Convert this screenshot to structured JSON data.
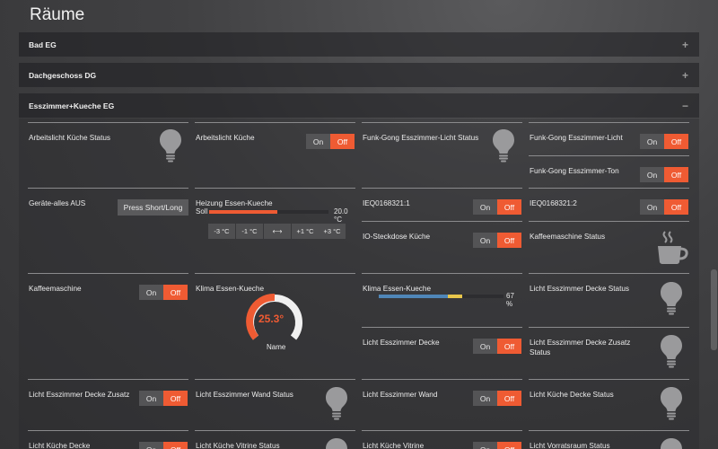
{
  "page": {
    "title": "Räume"
  },
  "panels": [
    {
      "label": "Bad EG",
      "toggle": "+"
    },
    {
      "label": "Dachgeschoss DG",
      "toggle": "+"
    },
    {
      "label": "Esszimmer+Kueche EG",
      "toggle": "−"
    }
  ],
  "switch": {
    "on": "On",
    "off": "Off"
  },
  "tiles": {
    "arbeitslicht_status": "Arbeitslicht Küche Status",
    "arbeitslicht": "Arbeitslicht Küche",
    "funkgong_status": "Funk-Gong Esszimmer-Licht Status",
    "funkgong_licht": "Funk-Gong Esszimmer-Licht",
    "funkgong_ton": "Funk-Gong Esszimmer-Ton",
    "geraete": "Geräte-alles AUS",
    "press_button": "Press Short/Long",
    "heizung": "Heizung Essen-Kueche",
    "heizung_soll_label": "Soll",
    "heizung_soll_value": "20.0 °C",
    "heizung_soll_fraction": 0.57,
    "ieq1": "IEQ0168321:1",
    "ieq2": "IEQ0168321:2",
    "io_steckdose": "IO-Steckdose Küche",
    "kaffee_status": "Kaffeemaschine Status",
    "kaffee": "Kaffeemaschine",
    "klima_gauge": "Klima Essen-Kueche",
    "klima_gauge_value": "25.3°",
    "klima_gauge_caption": "Name",
    "klima_bar": "Klima Essen-Kueche",
    "klima_bar_value": "67 %",
    "klima_bar_fraction": 0.67,
    "decke_status": "Licht Esszimmer Decke Status",
    "decke": "Licht Esszimmer Decke",
    "decke_zusatz_status": "Licht Esszimmer Decke Zusatz Status",
    "decke_zusatz": "Licht Esszimmer Decke Zusatz",
    "wand_status": "Licht Esszimmer Wand Status",
    "wand": "Licht Esszimmer Wand",
    "kueche_decke_status": "Licht Küche Decke Status",
    "kueche_decke": "Licht Küche Decke",
    "vitrine_status": "Licht Küche Vitrine Status",
    "vitrine": "Licht Küche Vitrine",
    "vorrat_status": "Licht Vorratsraum Status"
  },
  "stepper": [
    "-3 °C",
    "-1 °C",
    "⟷",
    "+1 °C",
    "+3 °C"
  ],
  "colors": {
    "accent": "#ef5b33",
    "bar_blue": "#4f86b8",
    "bar_yellow": "#e8c64b"
  }
}
